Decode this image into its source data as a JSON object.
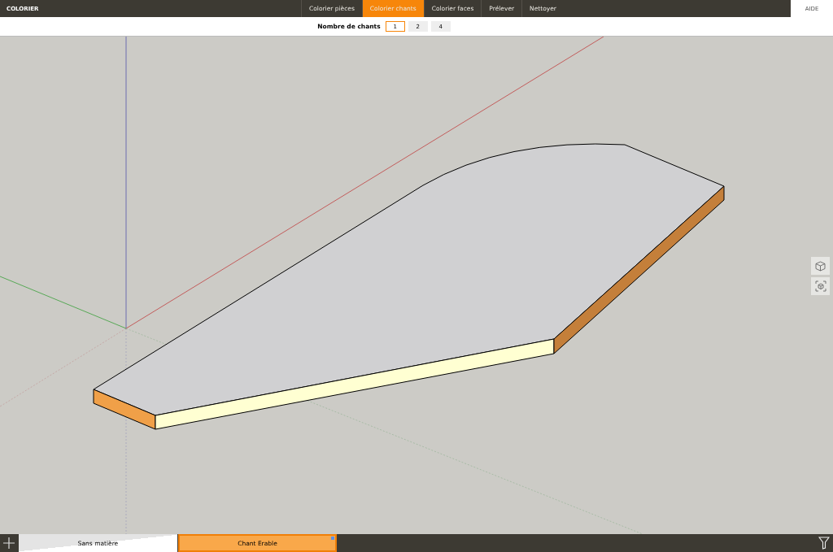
{
  "app_title": "COLORIER",
  "tabs": [
    {
      "label": "Colorier pièces",
      "selected": false
    },
    {
      "label": "Colorier chants",
      "selected": true
    },
    {
      "label": "Colorier faces",
      "selected": false
    },
    {
      "label": "Prélever",
      "selected": false
    },
    {
      "label": "Nettoyer",
      "selected": false
    }
  ],
  "help": "AIDE",
  "edge_count": {
    "label": "Nombre de chants",
    "options": [
      {
        "label": "1",
        "selected": true
      },
      {
        "label": "2",
        "selected": false
      },
      {
        "label": "4",
        "selected": false
      }
    ]
  },
  "materials": [
    {
      "label": "Sans matière",
      "kind": "none",
      "selected": false
    },
    {
      "label": "Chant Erable",
      "kind": "color",
      "color": "#f9a84a",
      "selected": true
    }
  ]
}
